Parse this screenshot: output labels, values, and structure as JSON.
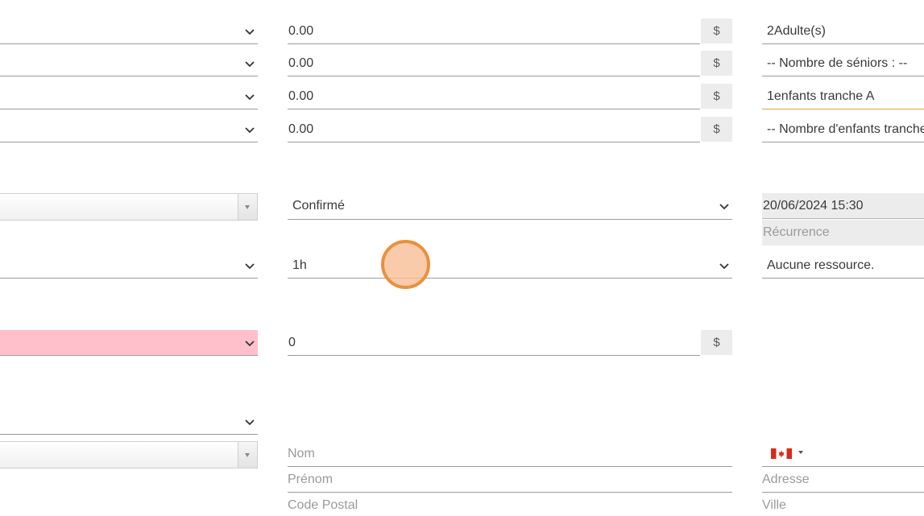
{
  "prices": [
    {
      "value": "0.00",
      "currency": "$"
    },
    {
      "value": "0.00",
      "currency": "$"
    },
    {
      "value": "0.00",
      "currency": "$"
    },
    {
      "value": "0.00",
      "currency": "$"
    }
  ],
  "participants": {
    "adults": "2Adulte(s)",
    "seniors": "-- Nombre de séniors : --",
    "children_a": "1enfants tranche A",
    "children_b": "-- Nombre d'enfants tranche B : --"
  },
  "status": {
    "value": "Confirmé"
  },
  "datetime": {
    "value": "20/06/2024 15:30"
  },
  "recurrence": {
    "placeholder": "Récurrence"
  },
  "duration": {
    "value": "1h"
  },
  "resource": {
    "value": "Aucune ressource."
  },
  "deposit": {
    "value": "0",
    "currency": "$"
  },
  "customer": {
    "nom_placeholder": "Nom",
    "prenom_placeholder": "Prénom",
    "code_postal_placeholder": "Code Postal",
    "adresse_placeholder": "Adresse",
    "ville_placeholder": "Ville",
    "phone_country_icon": "canada-flag-icon"
  },
  "colors": {
    "error_background": "#ffc0cb",
    "active_underline": "#e8a33d",
    "cursor_ring": "#e8913d",
    "readonly_background": "#ececec"
  }
}
